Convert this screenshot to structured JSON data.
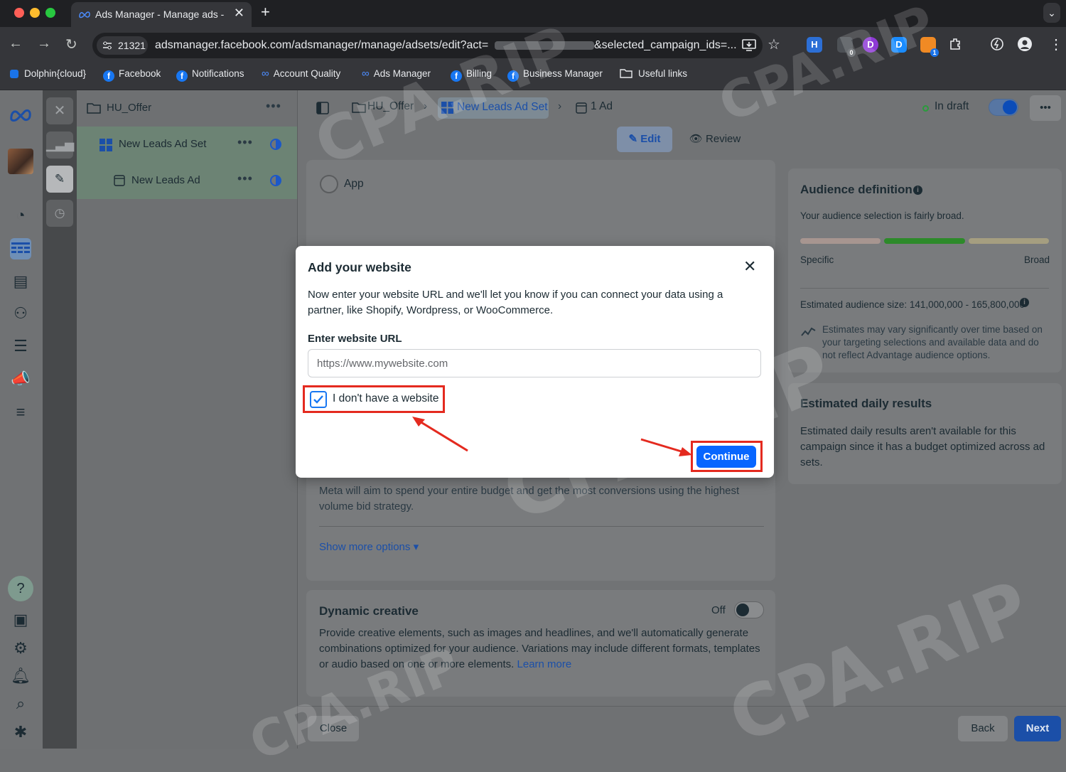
{
  "browser": {
    "tab_title": "Ads Manager - Manage ads -",
    "close_glyph": "✕",
    "new_tab_glyph": "+",
    "profile_chip": "21321",
    "url_start": "adsmanager.facebook.com/adsmanager/manage/adsets/edit?act=",
    "url_end": "&selected_campaign_ids=...",
    "ext_badge_1": "0",
    "ext_badge_2": "1",
    "bookmarks": [
      "Dolphin{cloud}",
      "Facebook",
      "Notifications",
      "Account Quality",
      "Ads Manager",
      "Billing",
      "Business Manager",
      "Useful links"
    ]
  },
  "tree": {
    "campaign": "HU_Offer",
    "adset": "New Leads Ad Set",
    "ad": "New Leads Ad",
    "more": "•••"
  },
  "header": {
    "crumb_campaign": "HU_Offer",
    "crumb_adset": "New Leads Ad Set",
    "crumb_ads": "1 Ad",
    "status": "In draft",
    "more": "•••",
    "edit": "Edit",
    "review": "Review"
  },
  "form": {
    "app_option": "App",
    "budget_text": "Meta will aim to spend your entire budget and get the most conversions using the highest volume bid strategy.",
    "show_more": "Show more options ▾",
    "dynamic_title": "Dynamic creative",
    "dynamic_toggle": "Off",
    "dynamic_text": "Provide creative elements, such as images and headlines, and we'll automatically generate combinations optimized for your audience. Variations may include different formats, templates or audio based on one or more elements.",
    "learn_more": "Learn more"
  },
  "right": {
    "aud_title": "Audience definition",
    "aud_sub": "Your audience selection is fairly broad.",
    "specific": "Specific",
    "broad": "Broad",
    "size": "Estimated audience size: 141,000,000 - 165,800,000",
    "note": "Estimates may vary significantly over time based on your targeting selections and available data and do not reflect Advantage audience options.",
    "daily_title": "Estimated daily results",
    "daily_text": "Estimated daily results aren't available for this campaign since it has a budget optimized across ad sets."
  },
  "footer": {
    "close": "Close",
    "back": "Back",
    "next": "Next"
  },
  "modal": {
    "title": "Add your website",
    "description": "Now enter your website URL and we'll let you know if you can connect your data using a partner, like Shopify, Wordpress, or WooCommerce.",
    "url_label": "Enter website URL",
    "url_placeholder": "https://www.mywebsite.com",
    "url_value": "",
    "checkbox_label": "I don't have a website",
    "checkbox_checked": true,
    "continue": "Continue"
  },
  "watermark": "CPA.RIP",
  "colors": {
    "accent": "#0866ff",
    "annotation": "#e42a1f"
  }
}
